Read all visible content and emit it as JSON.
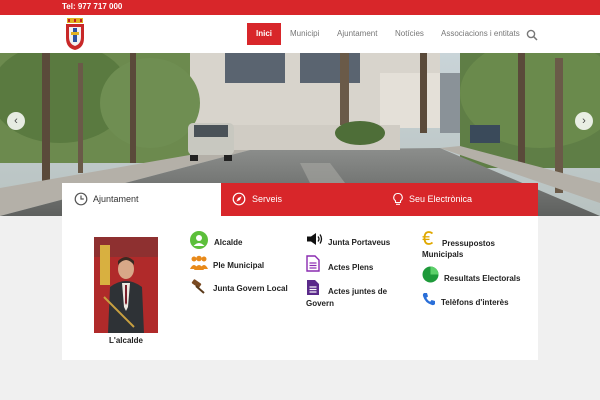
{
  "topbar": {
    "phone": "Tel: 977 717 000"
  },
  "nav": {
    "items": [
      {
        "label": "Inici",
        "active": true
      },
      {
        "label": "Municipi",
        "active": false
      },
      {
        "label": "Ajuntament",
        "active": false
      },
      {
        "label": "Notícies",
        "active": false
      },
      {
        "label": "Associacions i entitats",
        "active": false
      }
    ]
  },
  "tabs": [
    {
      "label": "Ajuntament",
      "icon": "clock-icon"
    },
    {
      "label": "Serveis",
      "icon": "compass-icon"
    },
    {
      "label": "Seu Electrònica",
      "icon": "lightbulb-icon"
    }
  ],
  "panel": {
    "photo_caption": "L'alcalde",
    "col1": [
      {
        "label": "Alcalde",
        "icon": "user-icon"
      },
      {
        "label": "Ple Municipal",
        "icon": "group-icon"
      },
      {
        "label": "Junta Govern Local",
        "icon": "gavel-icon"
      }
    ],
    "col2": [
      {
        "label": "Junta Portaveus",
        "icon": "speaker-icon"
      },
      {
        "label": "Actes Plens",
        "icon": "document-icon"
      },
      {
        "label_line1": "Actes juntes de",
        "label_line2": "Govern",
        "icon": "document-icon"
      }
    ],
    "col3": [
      {
        "label_line1": "Pressupostos",
        "label_line2": "Municipals",
        "icon": "euro-icon"
      },
      {
        "label": "Resultats Electorals",
        "icon": "pie-chart-icon"
      },
      {
        "label": "Telèfons d'interès",
        "icon": "phone-icon"
      }
    ]
  },
  "colors": {
    "brand": "#d8262a",
    "green": "#5cbf3a",
    "orange": "#e88a1a",
    "purple": "#8a2bb0",
    "blue": "#2a6fd8"
  }
}
